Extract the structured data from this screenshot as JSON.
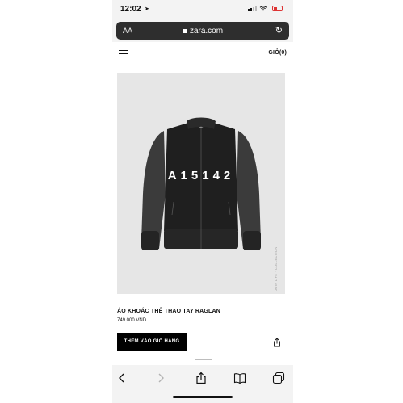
{
  "status_bar": {
    "time": "12:02"
  },
  "browser": {
    "text_size_label": "AA",
    "url": "zara.com"
  },
  "header": {
    "cart_label": "GIỎ(0)"
  },
  "product": {
    "print_text": "A15142",
    "side_caption": "JOIN LIFE · COLLECTION",
    "title": "ÁO KHOÁC THỂ THAO TAY RAGLAN",
    "price": "749.000 VND",
    "add_to_cart_label": "THÊM VÀO GIỎ HÀNG"
  },
  "toolbar": {
    "icons": [
      "back-icon",
      "forward-icon",
      "share-icon",
      "bookmarks-icon",
      "tabs-icon"
    ]
  }
}
